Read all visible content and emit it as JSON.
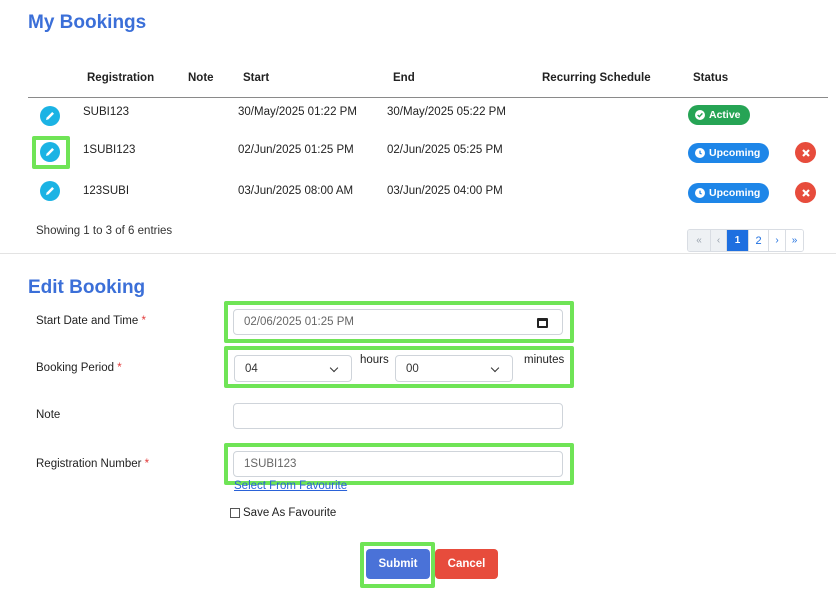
{
  "bookings": {
    "title": "My Bookings",
    "columns": [
      "Registration",
      "Note",
      "Start",
      "End",
      "Recurring Schedule",
      "Status"
    ],
    "rows": [
      {
        "registration": "SUBI123",
        "note": "",
        "start": "30/May/2025 01:22 PM",
        "end": "30/May/2025 05:22 PM",
        "recurring": "",
        "status": "Active",
        "status_color": "#26a455",
        "deletable": false
      },
      {
        "registration": "1SUBI123",
        "note": "",
        "start": "02/Jun/2025 01:25 PM",
        "end": "02/Jun/2025 05:25 PM",
        "recurring": "",
        "status": "Upcoming",
        "status_color": "#1e86e8",
        "deletable": true
      },
      {
        "registration": "123SUBI",
        "note": "",
        "start": "03/Jun/2025 08:00 AM",
        "end": "03/Jun/2025 04:00 PM",
        "recurring": "",
        "status": "Upcoming",
        "status_color": "#1e86e8",
        "deletable": true
      }
    ],
    "showing": "Showing 1 to 3 of 6 entries",
    "pagination": {
      "first": "«",
      "prev": "‹",
      "pages": [
        "1",
        "2"
      ],
      "current_page": "1",
      "next": "›",
      "last": "»"
    }
  },
  "edit": {
    "title": "Edit Booking",
    "start_label": "Start Date and Time",
    "start_value": "02/06/2025 01:25 PM",
    "period_label": "Booking Period",
    "hours_value": "04",
    "hours_unit": "hours",
    "minutes_value": "00",
    "minutes_unit": "minutes",
    "note_label": "Note",
    "note_value": "",
    "registration_label": "Registration Number",
    "registration_value": "1SUBI123",
    "select_favourite": "Select From Favourite",
    "save_favourite": "Save As Favourite",
    "submit": "Submit",
    "cancel": "Cancel",
    "required_mark": "*"
  },
  "icons": {
    "edit": "pencil-icon",
    "delete": "close-circle-icon",
    "active": "check-circle-icon",
    "upcoming": "clock-icon",
    "calendar": "calendar-icon",
    "dropdown": "chevron-down-icon"
  },
  "colors": {
    "accent": "#3b6fd8",
    "highlight": "#6fe456",
    "danger": "#e74c3c",
    "edit": "#1bb3e4"
  }
}
